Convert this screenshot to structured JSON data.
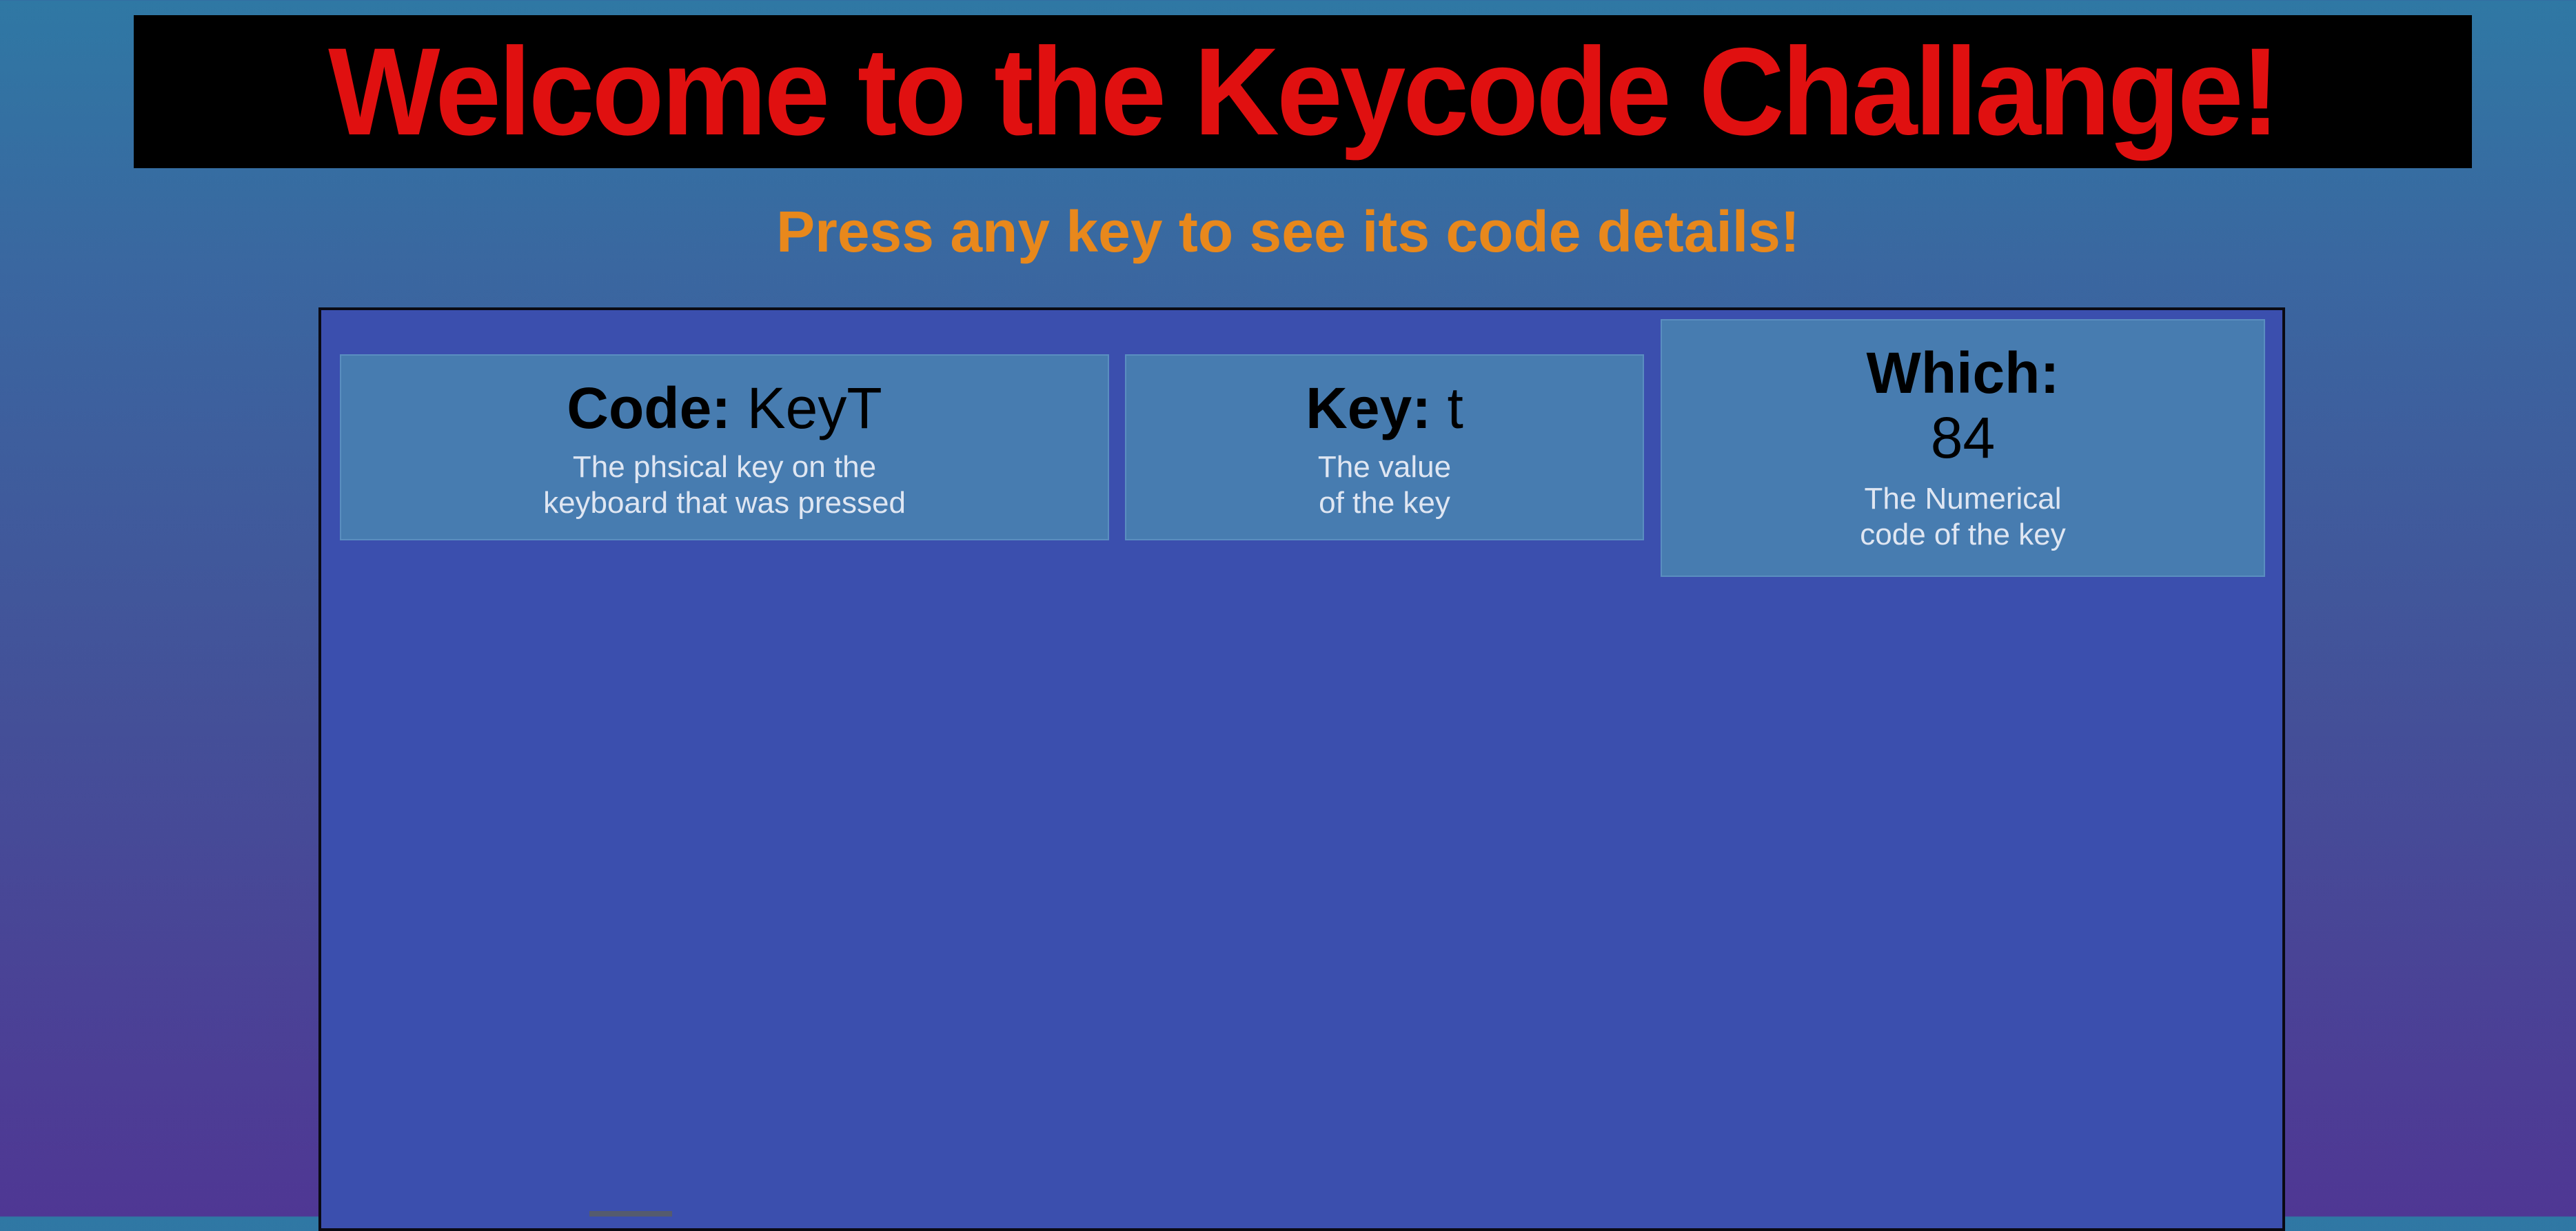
{
  "banner": {
    "title": "Welcome to the Keycode Challange!"
  },
  "subtitle": "Press any key to see its code details!",
  "cards": {
    "code": {
      "label": "Code:",
      "value": "KeyT",
      "desc_line1": "The phsical key on the",
      "desc_line2": "keyboard that was pressed"
    },
    "key": {
      "label": "Key:",
      "value": "t",
      "desc_line1": "The value",
      "desc_line2": "of the key"
    },
    "which": {
      "label": "Which:",
      "value": "84",
      "desc_line1": "The Numerical",
      "desc_line2": "code of the key"
    }
  },
  "colors": {
    "banner_bg": "#000000",
    "title": "#e01010",
    "subtitle": "#e8881c",
    "panel": "#3b4fae",
    "card": "#477cb0"
  }
}
